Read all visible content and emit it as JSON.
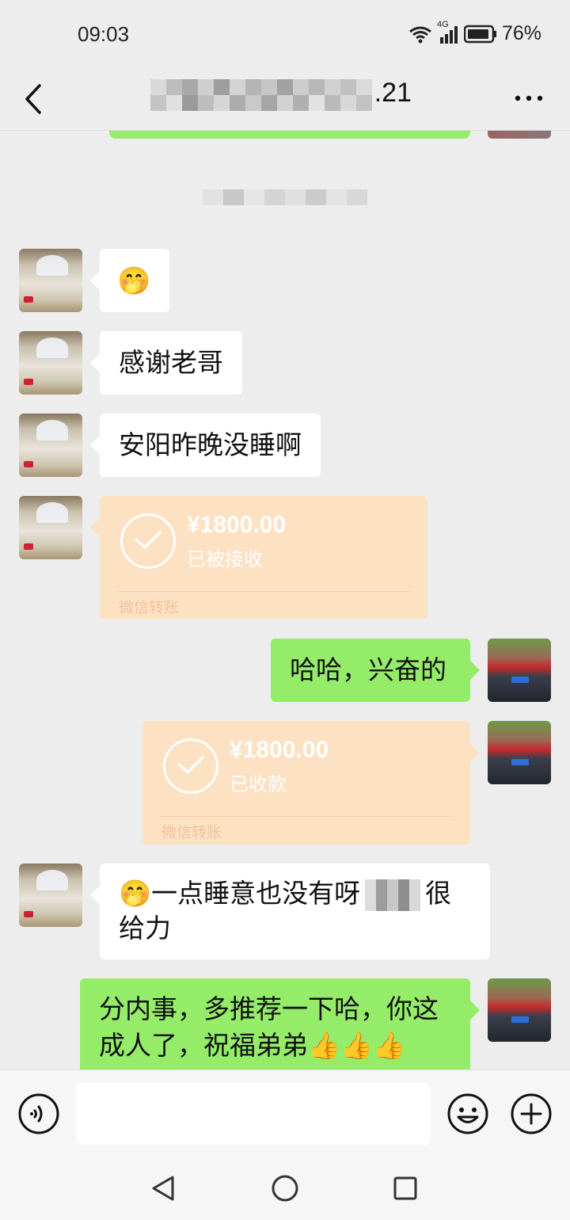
{
  "status_bar": {
    "time": "09:03",
    "network": "4G",
    "battery": "76%"
  },
  "header": {
    "title_suffix": ".21",
    "back_icon": "chevron-left-icon",
    "more_icon": "more-dots-icon"
  },
  "messages": [
    {
      "side": "left",
      "type": "emoji",
      "text": "🤭"
    },
    {
      "side": "left",
      "type": "text",
      "text": "感谢老哥"
    },
    {
      "side": "left",
      "type": "text",
      "text": "安阳昨晚没睡啊"
    },
    {
      "side": "left",
      "type": "transfer",
      "amount": "¥1800.00",
      "status": "已被接收",
      "label": "微信转账"
    },
    {
      "side": "right",
      "type": "text",
      "text": "哈哈，兴奋的"
    },
    {
      "side": "right",
      "type": "transfer",
      "amount": "¥1800.00",
      "status": "已收款",
      "label": "微信转账"
    },
    {
      "side": "left",
      "type": "text",
      "line1_prefix": "🤭一点睡意也没有呀",
      "line1_suffix": "很",
      "line2": "给力"
    },
    {
      "side": "right",
      "type": "text",
      "line1": "分内事，多推荐一下哈，你这",
      "line2": "成人了，祝福弟弟👍👍👍"
    }
  ],
  "input_bar": {
    "voice_icon": "voice-icon",
    "emoji_icon": "emoji-icon",
    "plus_icon": "plus-icon"
  },
  "colors": {
    "background": "#ededed",
    "green_bubble": "#95ec69",
    "white_bubble": "#ffffff",
    "transfer_bubble": "#fde1c3"
  }
}
